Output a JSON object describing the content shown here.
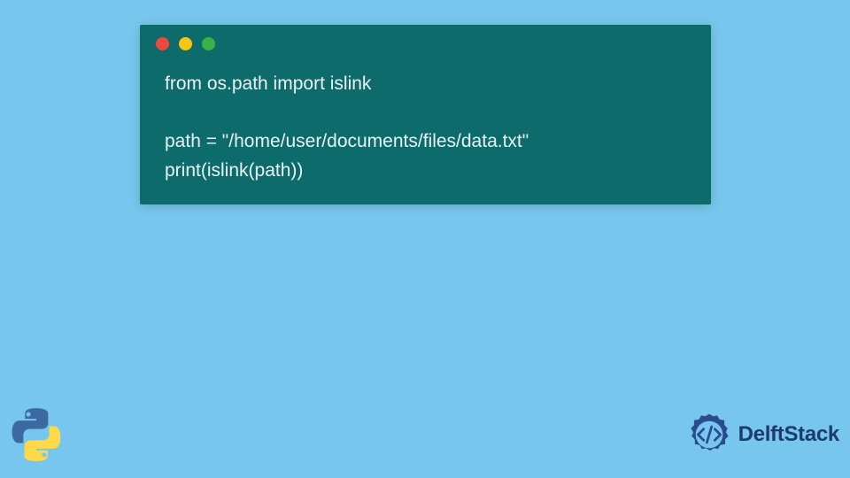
{
  "code": {
    "line1": "from os.path import islink",
    "line2": "path = \"/home/user/documents/files/data.txt\"",
    "line3": "print(islink(path))"
  },
  "brand": {
    "name": "DelftStack"
  },
  "colors": {
    "background": "#77c6ed",
    "codeWindow": "#0e6b6b",
    "codeText": "#e8f4f4",
    "dotRed": "#e94b3c",
    "dotYellow": "#f5c518",
    "dotGreen": "#3bb14a",
    "brandText": "#1e3a6e"
  },
  "icons": {
    "pythonLogo": "python-logo",
    "delftIcon": "code-gear-icon"
  }
}
